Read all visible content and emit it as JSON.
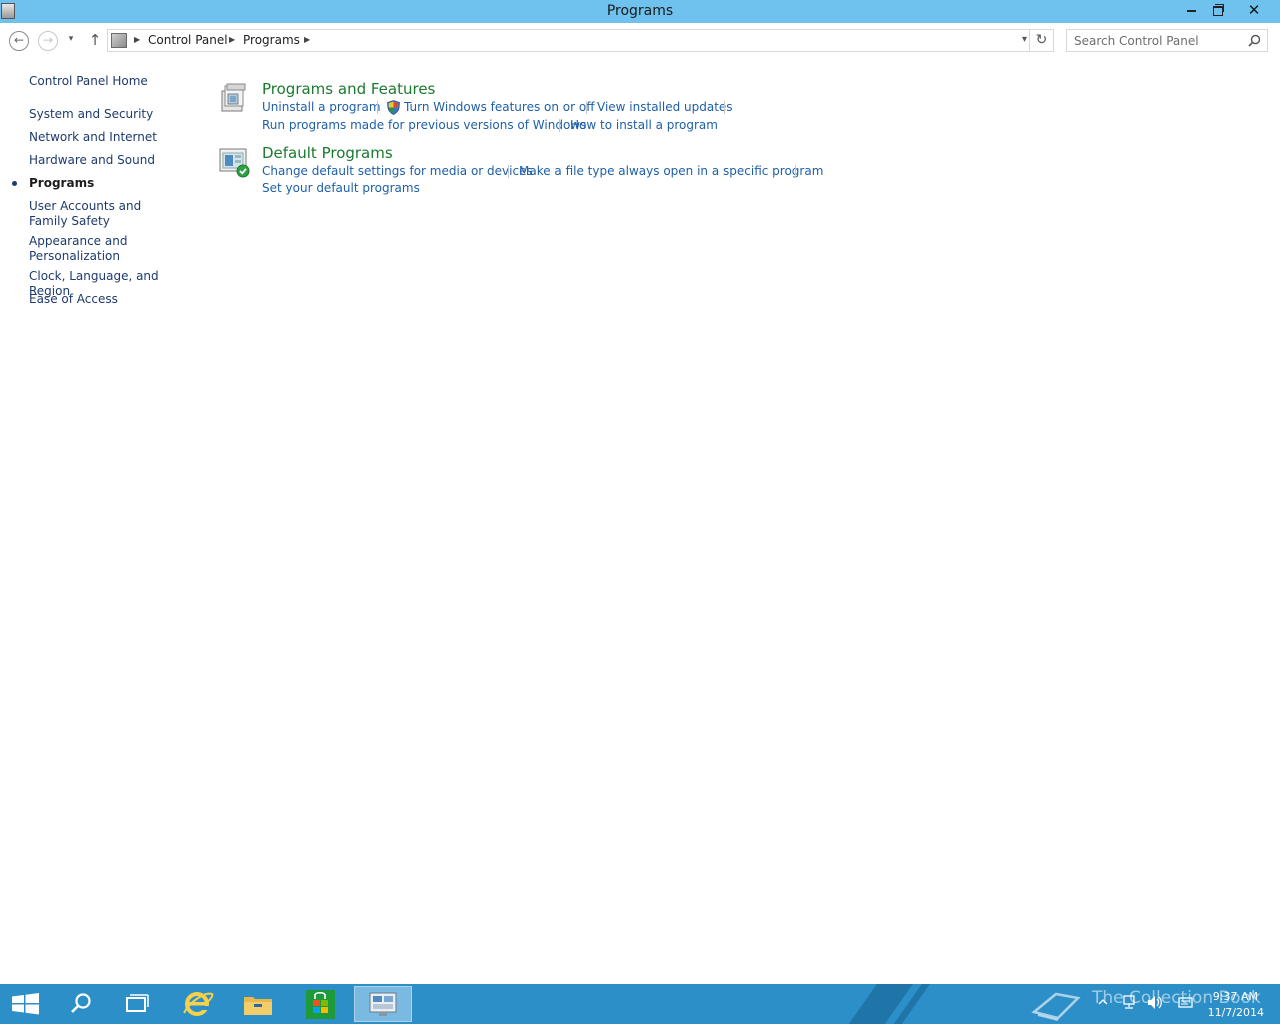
{
  "window": {
    "title": "Programs",
    "minimize_label": "",
    "close_label": "✕"
  },
  "navigation": {
    "back_glyph": "←",
    "forward_glyph": "→",
    "recent_glyph": "▾",
    "up_glyph": "↑"
  },
  "address_bar": {
    "breadcrumbs": [
      "Control Panel",
      "Programs"
    ],
    "separator_glyph": "▶",
    "dropdown_glyph": "▾",
    "refresh_glyph": "↻"
  },
  "search": {
    "placeholder": "Search Control Panel",
    "value": ""
  },
  "sidebar": {
    "items": [
      {
        "label": "Control Panel Home",
        "active": false
      },
      {
        "label": "System and Security",
        "active": false
      },
      {
        "label": "Network and Internet",
        "active": false
      },
      {
        "label": "Hardware and Sound",
        "active": false
      },
      {
        "label": "Programs",
        "active": true
      },
      {
        "label": "User Accounts and Family Safety",
        "active": false
      },
      {
        "label": "Appearance and Personalization",
        "active": false
      },
      {
        "label": "Clock, Language, and Region",
        "active": false
      },
      {
        "label": "Ease of Access",
        "active": false
      }
    ]
  },
  "categories": [
    {
      "title": "Programs and Features",
      "icon": "programs-features-icon",
      "tasks": [
        {
          "label": "Uninstall a program"
        },
        {
          "label": "Turn Windows features on or off",
          "icon": "shield-icon"
        },
        {
          "label": "View installed updates"
        },
        {
          "label": "Run programs made for previous versions of Windows"
        },
        {
          "label": "How to install a program"
        }
      ]
    },
    {
      "title": "Default Programs",
      "icon": "default-programs-icon",
      "tasks": [
        {
          "label": "Change default settings for media or devices"
        },
        {
          "label": "Make a file type always open in a specific program"
        },
        {
          "label": "Set your default programs"
        }
      ]
    }
  ],
  "taskbar": {
    "pinned": [
      "start-icon",
      "search-icon",
      "task-view-icon",
      "internet-explorer-icon",
      "file-explorer-icon",
      "store-icon",
      "control-panel-icon"
    ],
    "clock_time": "9:37 AM",
    "clock_date": "11/7/2014",
    "watermark": "The Collection Book"
  },
  "colors": {
    "titlebar": "#6fc2ee",
    "taskbar": "#2d8fc8",
    "category_title": "#1a7a2e",
    "task_link": "#1e5fa8",
    "sidebar_link": "#1e3a6e"
  }
}
